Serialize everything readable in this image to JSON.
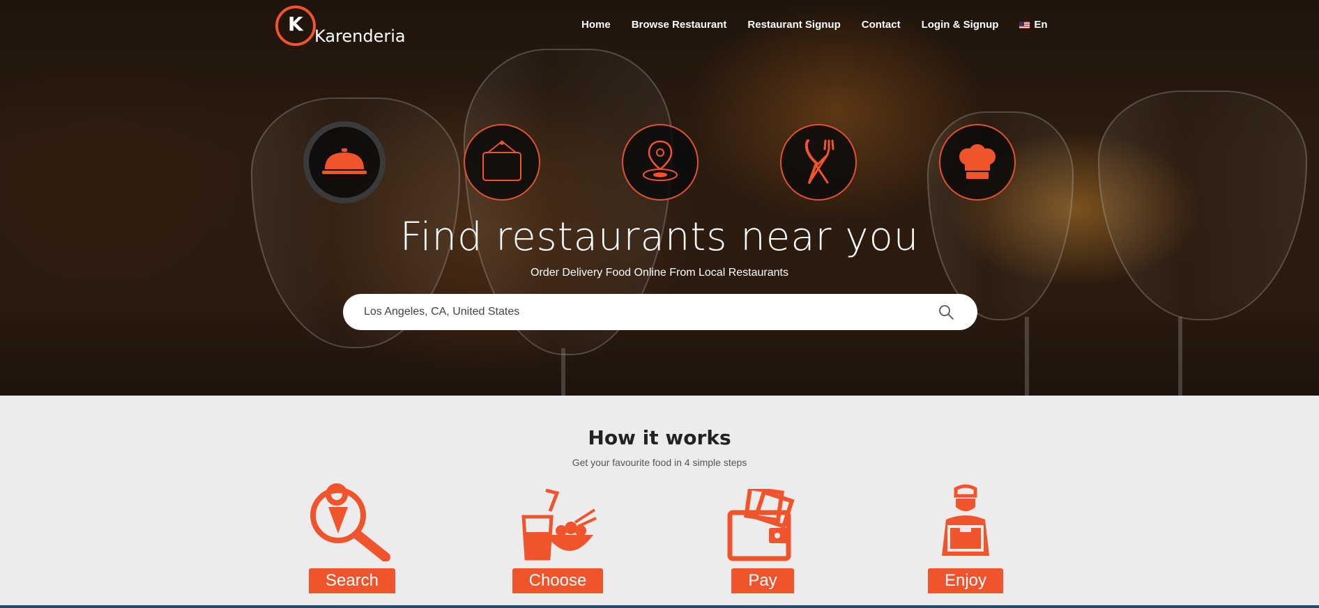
{
  "brand": {
    "logo_letter": "K",
    "name": "Karenderia",
    "accent": "#f0542d"
  },
  "nav": {
    "items": [
      "Home",
      "Browse Restaurant",
      "Restaurant Signup",
      "Contact",
      "Login & Signup"
    ],
    "language": "En"
  },
  "hero": {
    "icons": [
      "cloche-icon",
      "sign-icon",
      "map-pin-icon",
      "fork-knife-icon",
      "chef-hat-icon"
    ],
    "title": "Find restaurants near you",
    "subtitle": "Order Delivery Food Online From Local Restaurants",
    "search": {
      "value": "Los Angeles, CA, United States"
    }
  },
  "how": {
    "title": "How it works",
    "subtitle": "Get your favourite food in 4 simple steps",
    "steps": [
      {
        "label": "Search",
        "icon": "location-search-icon"
      },
      {
        "label": "Choose",
        "icon": "food-bowl-icon"
      },
      {
        "label": "Pay",
        "icon": "wallet-icon"
      },
      {
        "label": "Enjoy",
        "icon": "delivery-person-icon"
      }
    ]
  }
}
